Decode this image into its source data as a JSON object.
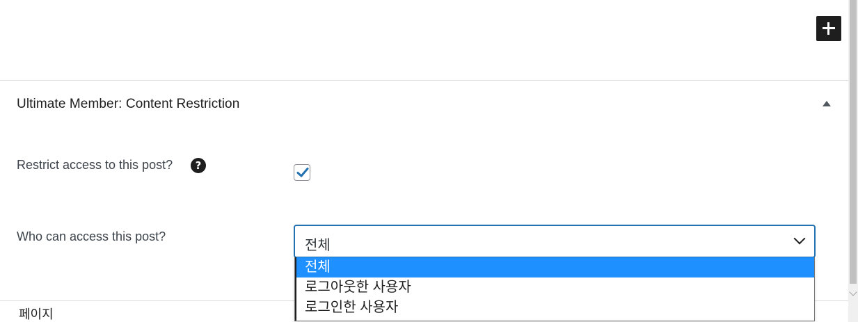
{
  "panel": {
    "title": "Ultimate Member: Content Restriction"
  },
  "fields": {
    "restrict_label": "Restrict access to this post?",
    "restrict_checked": true,
    "help_glyph": "?",
    "who_label": "Who can access this post?",
    "who_selected": "전체",
    "who_options": [
      "전체",
      "로그아웃한 사용자",
      "로그인한 사용자"
    ]
  },
  "bottom": {
    "label": "페이지"
  },
  "colors": {
    "accent": "#2271b1",
    "selected_option": "#1e90ff",
    "dark": "#1e1e1e"
  },
  "icons": {
    "add": "plus-icon",
    "toggle": "triangle-up-icon",
    "help": "question-circle-icon",
    "check": "checkmark-icon",
    "select": "chevron-down-icon"
  }
}
